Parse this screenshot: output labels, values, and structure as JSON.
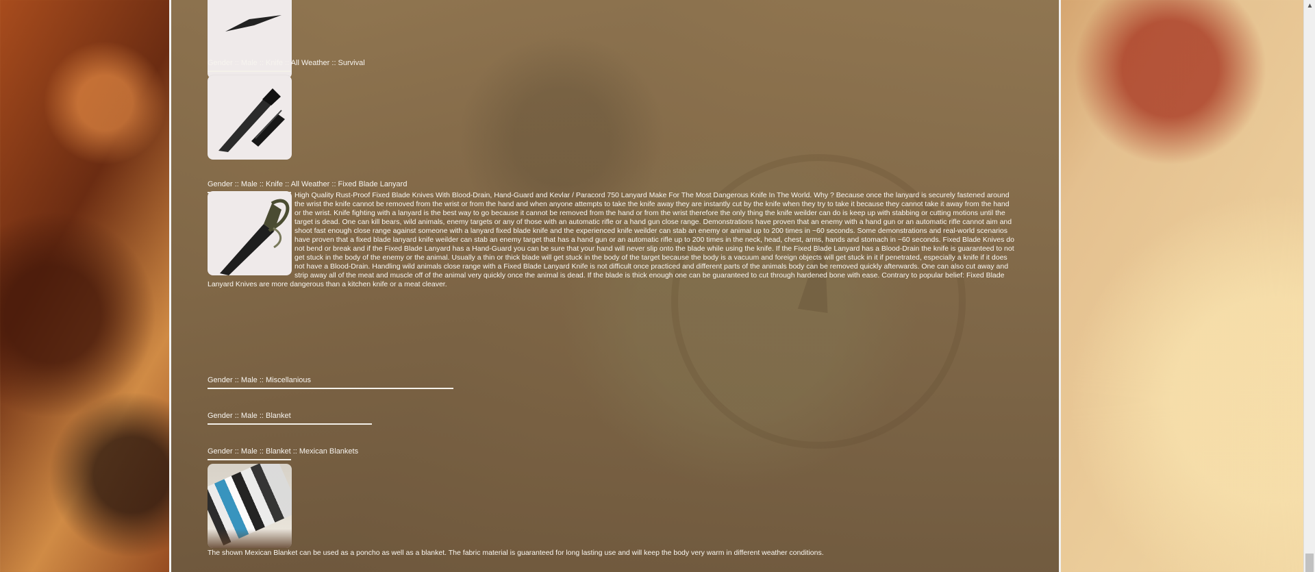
{
  "sections": [
    {
      "breadcrumb": "Gender :: Male :: Knife :: All Weather :: Survival"
    },
    {
      "breadcrumb": "Gender :: Male :: Knife :: All Weather :: Fixed Blade Lanyard",
      "description": "High Quality Rust-Proof Fixed Blade Knives With Blood-Drain, Hand-Guard and Kevlar / Paracord 750 Lanyard Make For The Most Dangerous Knife In The World. Why ? Because once the lanyard is securely fastened around the wrist the knife cannot be removed from the wrist or from the hand and when anyone attempts to take the knife away they are instantly cut by the knife when they try to take it because they cannot take it away from the hand or the wrist. Knife fighting with a lanyard is the best way to go because it cannot be removed from the hand or from the wrist therefore the only thing the knife weilder can do is keep up with stabbing or cutting motions until the target is dead. One can kill bears, wild animals, enemy targets or any of those with an automatic rifle or a hand gun close range. Demonstrations have proven that an enemy with a hand gun or an automatic rifle cannot aim and shoot fast enough close range against someone with a lanyard fixed blade knife and the experienced knife weilder can stab an enemy or animal up to 200 times in ~60 seconds. Some demonstrations and real-world scenarios have proven that a fixed blade lanyard knife weilder can stab an enemy target that has a hand gun or an automatic rifle up to 200 times in the neck, head, chest, arms, hands and stomach in ~60 seconds. Fixed Blade Knives do not bend or break and if the Fixed Blade Lanyard has a Hand-Guard you can be sure that your hand will never slip onto the blade while using the knife. If the Fixed Blade Lanyard has a Blood-Drain the knife is guaranteed to not get stuck in the body of the enemy or the animal. Usually a thin or thick blade will get stuck in the body of the target because the body is a vacuum and foreign objects will get stuck in it if penetrated, especially a knife if it does not have a Blood-Drain. Handling wild animals close range with a Fixed Blade Lanyard Knife is not difficult once practiced and different parts of the animals body can be removed quickly afterwards. One can also cut away and strip away all of the meat and muscle off of the animal very quickly once the animal is dead. If the blade is thick enough one can be guaranteed to cut through hardened bone with ease. Contrary to popular belief: Fixed Blade Lanyard Knives are more dangerous than a kitchen knife or a meat cleaver."
    },
    {
      "breadcrumb": "Gender :: Male :: Miscellanious"
    },
    {
      "breadcrumb": "Gender :: Male :: Blanket"
    },
    {
      "breadcrumb": "Gender :: Male :: Blanket :: Mexican Blankets",
      "description": "The shown Mexican Blanket can be used as a poncho as well as a blanket. The fabric material is guaranteed for long lasting use and will keep the body very warm in different weather conditions."
    }
  ],
  "icons": {
    "scroll_up": "chevron-up-icon"
  }
}
